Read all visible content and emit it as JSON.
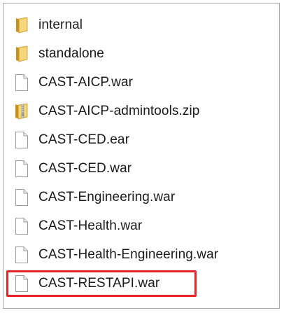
{
  "files": [
    {
      "name": "internal",
      "icon": "folder-icon"
    },
    {
      "name": "standalone",
      "icon": "folder-icon"
    },
    {
      "name": "CAST-AICP.war",
      "icon": "file-icon"
    },
    {
      "name": "CAST-AICP-admintools.zip",
      "icon": "zip-folder-icon"
    },
    {
      "name": "CAST-CED.ear",
      "icon": "file-icon"
    },
    {
      "name": "CAST-CED.war",
      "icon": "file-icon"
    },
    {
      "name": "CAST-Engineering.war",
      "icon": "file-icon"
    },
    {
      "name": "CAST-Health.war",
      "icon": "file-icon"
    },
    {
      "name": "CAST-Health-Engineering.war",
      "icon": "file-icon"
    },
    {
      "name": "CAST-RESTAPI.war",
      "icon": "file-icon",
      "highlighted": true
    }
  ],
  "colors": {
    "highlight_border": "#e8242a",
    "folder": "#e8b84a",
    "text": "#1a1a1a"
  }
}
